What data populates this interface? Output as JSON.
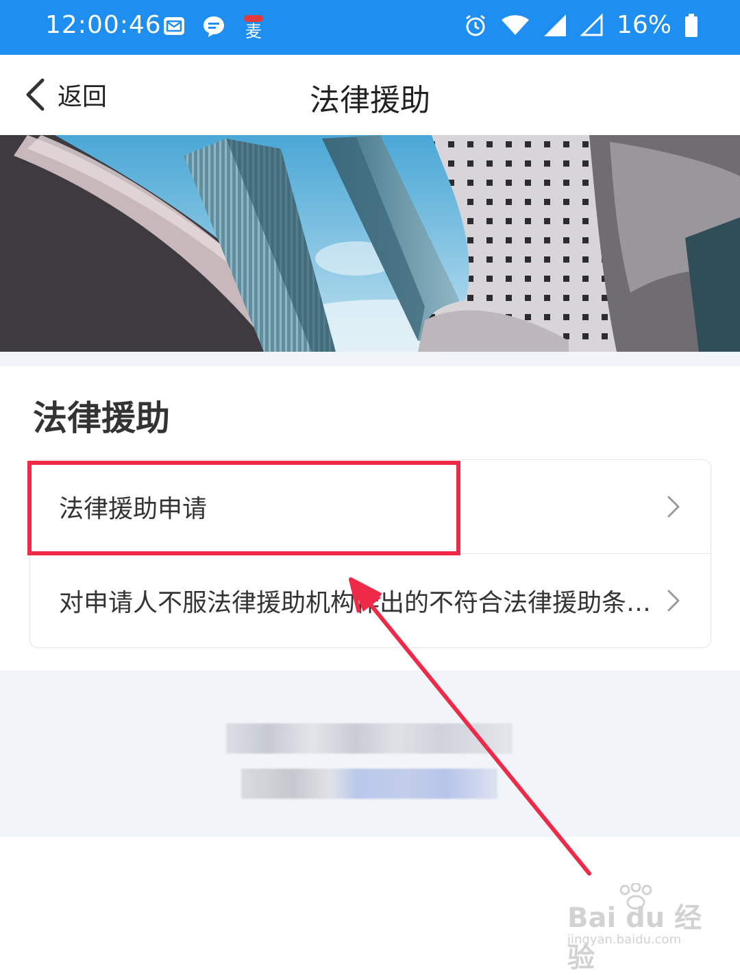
{
  "status_bar": {
    "time": "12:00:46",
    "battery": "16%",
    "icons": [
      "mail-icon",
      "message-icon",
      "app-icon",
      "alarm-icon",
      "wifi-icon",
      "signal-icon",
      "signal-empty-icon",
      "battery-icon"
    ],
    "app_icon_text": "麦"
  },
  "nav": {
    "back_label": "返回",
    "title": "法律援助"
  },
  "section": {
    "title": "法律援助"
  },
  "list": {
    "items": [
      {
        "label": "法律援助申请"
      },
      {
        "label": "对申请人不服法律援助机构作出的不符合法律援助条…"
      }
    ]
  },
  "watermark": {
    "brand": "Bai du 经验",
    "sub": "jingyan.baidu.com"
  },
  "colors": {
    "status_bar": "#1e8ef0",
    "annotation_red": "#ef2a48",
    "footer_bg": "#f1f4f8"
  }
}
